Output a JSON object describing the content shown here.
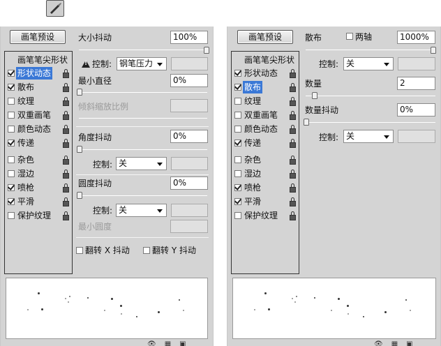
{
  "left": {
    "preset_button": "画笔预设",
    "list_header": "画笔笔尖形状",
    "list": [
      {
        "label": "形状动态",
        "checked": true,
        "active": true
      },
      {
        "label": "散布",
        "checked": true,
        "active": false
      },
      {
        "label": "纹理",
        "checked": false,
        "active": false
      },
      {
        "label": "双重画笔",
        "checked": false,
        "active": false
      },
      {
        "label": "颜色动态",
        "checked": false,
        "active": false
      },
      {
        "label": "传递",
        "checked": true,
        "active": false
      },
      {
        "label": "杂色",
        "checked": false,
        "active": false
      },
      {
        "label": "湿边",
        "checked": false,
        "active": false
      },
      {
        "label": "喷枪",
        "checked": true,
        "active": false
      },
      {
        "label": "平滑",
        "checked": true,
        "active": false
      },
      {
        "label": "保护纹理",
        "checked": false,
        "active": false
      }
    ],
    "size_jitter_label": "大小抖动",
    "size_jitter_value": "100%",
    "control_label": "控制:",
    "control1_value": "钢笔压力",
    "min_diameter_label": "最小直径",
    "min_diameter_value": "0%",
    "tilt_scale_label": "倾斜缩放比例",
    "angle_jitter_label": "角度抖动",
    "angle_jitter_value": "0%",
    "control2_label": "控制:",
    "control2_value": "关",
    "roundness_jitter_label": "圆度抖动",
    "roundness_jitter_value": "0%",
    "control3_label": "控制:",
    "control3_value": "关",
    "min_roundness_label": "最小圆度",
    "flip_x_label": "翻转 X 抖动",
    "flip_y_label": "翻转 Y 抖动"
  },
  "right": {
    "preset_button": "画笔预设",
    "list_header": "画笔笔尖形状",
    "list": [
      {
        "label": "形状动态",
        "checked": true,
        "active": false
      },
      {
        "label": "散布",
        "checked": true,
        "active": true
      },
      {
        "label": "纹理",
        "checked": false,
        "active": false
      },
      {
        "label": "双重画笔",
        "checked": false,
        "active": false
      },
      {
        "label": "颜色动态",
        "checked": false,
        "active": false
      },
      {
        "label": "传递",
        "checked": true,
        "active": false
      },
      {
        "label": "杂色",
        "checked": false,
        "active": false
      },
      {
        "label": "湿边",
        "checked": false,
        "active": false
      },
      {
        "label": "喷枪",
        "checked": true,
        "active": false
      },
      {
        "label": "平滑",
        "checked": true,
        "active": false
      },
      {
        "label": "保护纹理",
        "checked": false,
        "active": false
      }
    ],
    "scatter_label": "散布",
    "both_axes_label": "两轴",
    "scatter_value": "1000%",
    "control_label": "控制:",
    "control1_value": "关",
    "count_label": "数量",
    "count_value": "2",
    "count_jitter_label": "数量抖动",
    "count_jitter_value": "0%",
    "control2_label": "控制:",
    "control2_value": "关"
  }
}
